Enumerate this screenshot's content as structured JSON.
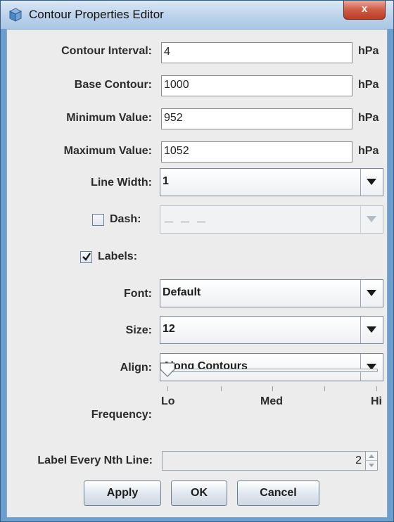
{
  "window": {
    "title": "Contour Properties Editor",
    "close_label": "x"
  },
  "fields": {
    "contour_interval": {
      "label": "Contour Interval:",
      "value": "4",
      "unit": "hPa"
    },
    "base_contour": {
      "label": "Base Contour:",
      "value": "1000",
      "unit": "hPa"
    },
    "minimum_value": {
      "label": "Minimum Value:",
      "value": "952",
      "unit": "hPa"
    },
    "maximum_value": {
      "label": "Maximum Value:",
      "value": "1052",
      "unit": "hPa"
    }
  },
  "line_width": {
    "label": "Line Width:",
    "value": "1"
  },
  "dash": {
    "label": "Dash:",
    "checked": false,
    "value_pattern": "_ _ _"
  },
  "labels": {
    "label": "Labels:",
    "checked": true
  },
  "font": {
    "label": "Font:",
    "value": "Default"
  },
  "size": {
    "label": "Size:",
    "value": "12"
  },
  "align": {
    "label": "Align:",
    "value": "Along Contours"
  },
  "frequency": {
    "label": "Frequency:",
    "tick_labels": [
      "Lo",
      "Med",
      "Hi"
    ],
    "level": 0
  },
  "label_every": {
    "label": "Label Every Nth Line:",
    "value": "2"
  },
  "buttons": {
    "apply": "Apply",
    "ok": "OK",
    "cancel": "Cancel"
  },
  "colors": {
    "title_bar": "#bcd2ea",
    "close_button": "#cf5b45",
    "panel": "#ececec"
  }
}
